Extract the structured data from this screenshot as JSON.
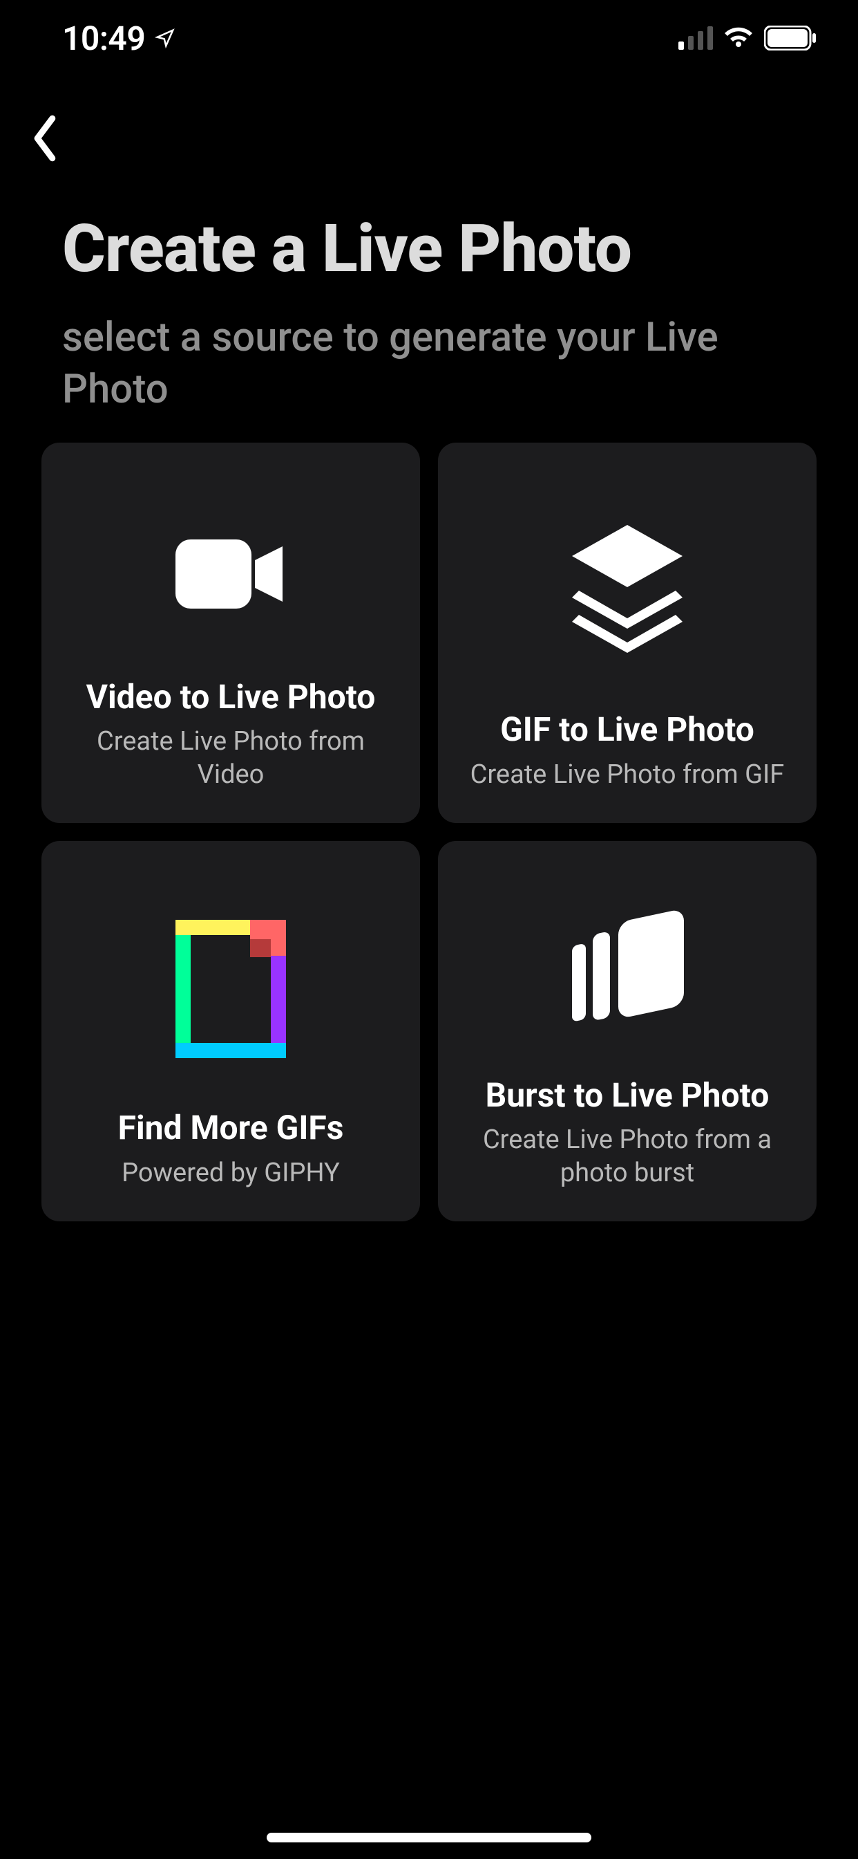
{
  "status": {
    "time": "10:49"
  },
  "page": {
    "title": "Create a Live Photo",
    "subtitle": "select a source to generate your Live Photo"
  },
  "cards": {
    "video": {
      "title": "Video to Live Photo",
      "subtitle": "Create Live Photo from Video"
    },
    "gif": {
      "title": "GIF to Live Photo",
      "subtitle": "Create Live Photo from GIF"
    },
    "giphy": {
      "title": "Find More GIFs",
      "subtitle": "Powered by GIPHY"
    },
    "burst": {
      "title": "Burst to Live Photo",
      "subtitle": "Create Live Photo from a photo burst"
    }
  }
}
